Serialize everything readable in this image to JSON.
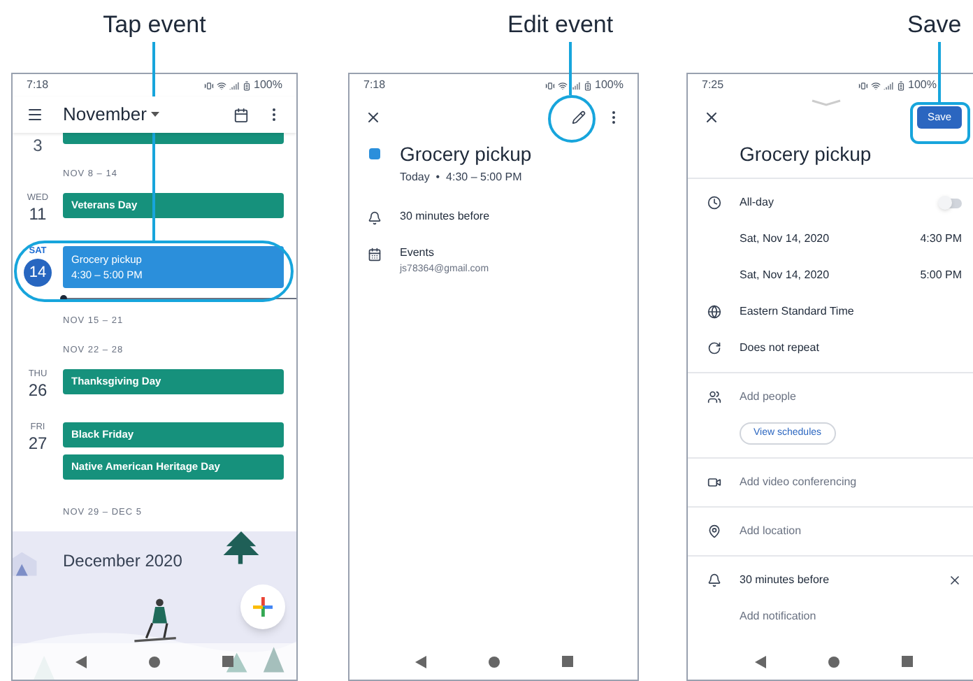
{
  "agenda_screen": {
    "caption": "Tap event",
    "status_bar": {
      "time": "7:18",
      "battery": "100%"
    },
    "header": {
      "month": "November"
    },
    "rows": [
      {
        "kind": "cut_day",
        "date": "3"
      },
      {
        "kind": "week",
        "label": "NOV 8 – 14"
      },
      {
        "kind": "day",
        "weekday": "WED",
        "date": "11",
        "selected": false,
        "events": [
          {
            "title": "Veterans Day",
            "selected": false
          }
        ]
      },
      {
        "kind": "day",
        "weekday": "SAT",
        "date": "14",
        "selected": true,
        "events": [
          {
            "title": "Grocery pickup",
            "time": "4:30 – 5:00 PM",
            "selected": true
          }
        ]
      },
      {
        "kind": "now"
      },
      {
        "kind": "week",
        "label": "NOV 15 – 21"
      },
      {
        "kind": "week",
        "label": "NOV 22 – 28"
      },
      {
        "kind": "day",
        "weekday": "THU",
        "date": "26",
        "selected": false,
        "events": [
          {
            "title": "Thanksgiving Day",
            "selected": false
          }
        ]
      },
      {
        "kind": "day",
        "weekday": "FRI",
        "date": "27",
        "selected": false,
        "events": [
          {
            "title": "Black Friday",
            "selected": false
          },
          {
            "title": "Native American Heritage Day",
            "selected": false
          }
        ]
      },
      {
        "kind": "week",
        "label": "NOV 29 – DEC 5"
      },
      {
        "kind": "month",
        "label": "December 2020"
      }
    ]
  },
  "event_screen": {
    "caption": "Edit event",
    "status_bar": {
      "time": "7:18",
      "battery": "100%"
    },
    "title": "Grocery pickup",
    "when": "Today  •  4:30 – 5:00 PM",
    "details": [
      {
        "kind": "reminder",
        "text": "30 minutes before"
      },
      {
        "kind": "calendar",
        "text": "Events",
        "subtext": "js78364@gmail.com"
      }
    ]
  },
  "edit_screen": {
    "caption": "Save",
    "status_bar": {
      "time": "7:25",
      "battery": "100%"
    },
    "save_button": "Save",
    "title": "Grocery pickup",
    "sections": [
      {
        "rows": [
          {
            "kind": "all_day",
            "text": "All-day",
            "on": false
          },
          {
            "kind": "time",
            "text": "Sat, Nov 14, 2020",
            "time": "4:30 PM"
          },
          {
            "kind": "time",
            "text": "Sat, Nov 14, 2020",
            "time": "5:00 PM"
          },
          {
            "kind": "timezone",
            "text": "Eastern Standard Time"
          },
          {
            "kind": "repeat",
            "text": "Does not repeat"
          }
        ]
      },
      {
        "rows": [
          {
            "kind": "people",
            "text": "Add people"
          },
          {
            "kind": "button",
            "text": "View schedules"
          }
        ]
      },
      {
        "rows": [
          {
            "kind": "video",
            "text": "Add video conferencing"
          }
        ]
      },
      {
        "rows": [
          {
            "kind": "location",
            "text": "Add location"
          }
        ]
      },
      {
        "rows": [
          {
            "kind": "reminder",
            "text": "30 minutes before"
          },
          {
            "kind": "add",
            "text": "Add notification"
          }
        ]
      }
    ]
  }
}
